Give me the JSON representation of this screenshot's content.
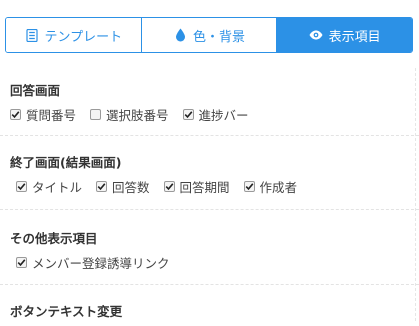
{
  "tabs": [
    {
      "label": "テンプレート",
      "icon": "document-list-icon",
      "active": false
    },
    {
      "label": "色・背景",
      "icon": "droplet-icon",
      "active": false
    },
    {
      "label": "表示項目",
      "icon": "eye-icon",
      "active": true
    }
  ],
  "colors": {
    "accent": "#2c91e6"
  },
  "sections": {
    "answer_screen": {
      "title": "回答画面",
      "options": [
        {
          "label": "質問番号",
          "checked": true
        },
        {
          "label": "選択肢番号",
          "checked": false
        },
        {
          "label": "進捗バー",
          "checked": true
        }
      ]
    },
    "end_screen": {
      "title": "終了画面(結果画面)",
      "options": [
        {
          "label": "タイトル",
          "checked": true
        },
        {
          "label": "回答数",
          "checked": true
        },
        {
          "label": "回答期間",
          "checked": true
        },
        {
          "label": "作成者",
          "checked": true
        }
      ]
    },
    "other_items": {
      "title": "その他表示項目",
      "options": [
        {
          "label": "メンバー登録誘導リンク",
          "checked": true
        }
      ]
    },
    "button_text": {
      "title": "ボタンテキスト変更"
    }
  }
}
